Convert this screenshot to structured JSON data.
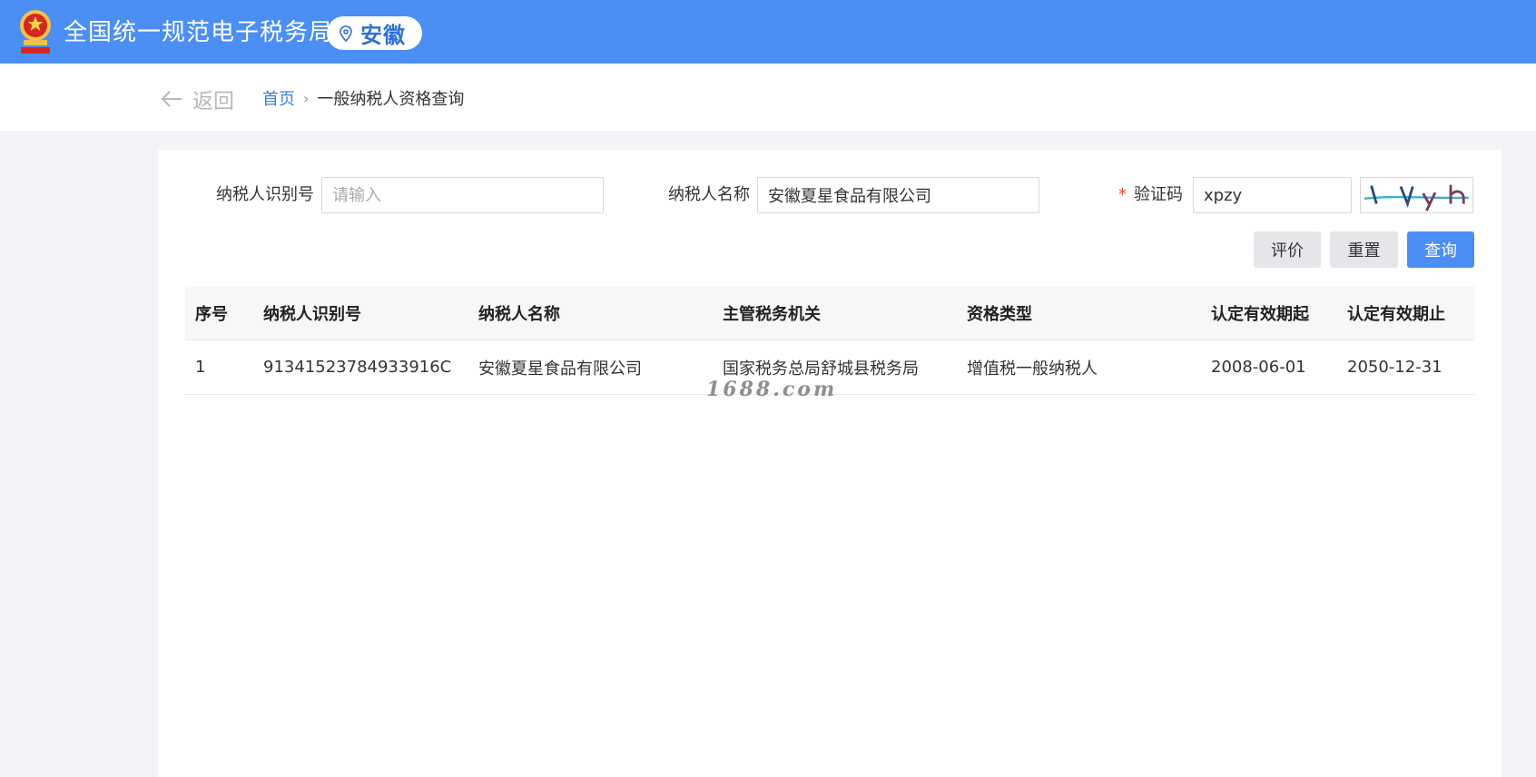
{
  "header": {
    "site_title": "全国统一规范电子税务局",
    "region": "安徽",
    "emblem_icon": "national-emblem-icon",
    "brand_color": "#4b8ff4"
  },
  "breadcrumb": {
    "back_label": "返回",
    "home_label": "首页",
    "separator": "›",
    "current_label": "一般纳税人资格查询"
  },
  "form": {
    "taxpayer_id_label": "纳税人识别号",
    "taxpayer_id_placeholder": "请输入",
    "taxpayer_id_value": "",
    "taxpayer_name_label": "纳税人名称",
    "taxpayer_name_value": "安徽夏星食品有限公司",
    "captcha_required_mark": "*",
    "captcha_label": "验证码",
    "captcha_value": "xpzy"
  },
  "buttons": {
    "evaluate": "评价",
    "reset": "重置",
    "query": "查询"
  },
  "table": {
    "headers": [
      "序号",
      "纳税人识别号",
      "纳税人名称",
      "主管税务机关",
      "资格类型",
      "认定有效期起",
      "认定有效期止"
    ],
    "rows": [
      [
        "1",
        "91341523784933916C",
        "安徽夏星食品有限公司",
        "国家税务总局舒城县税务局",
        "增值税一般纳税人",
        "2008-06-01",
        "2050-12-31"
      ]
    ]
  },
  "watermark": "1688.com"
}
